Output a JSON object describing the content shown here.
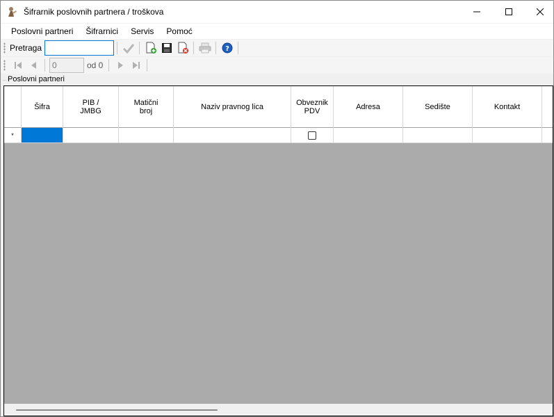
{
  "window": {
    "title": "Šifrarnik poslovnih partnera / troškova"
  },
  "menu": [
    "Poslovni partneri",
    "Šifrarnici",
    "Servis",
    "Pomoć"
  ],
  "search": {
    "label": "Pretraga",
    "value": "",
    "placeholder": ""
  },
  "toolbar": {
    "icons": [
      "check-icon",
      "add-document-icon",
      "save-icon",
      "delete-document-icon",
      "print-icon",
      "help-icon"
    ]
  },
  "navigator": {
    "position": "0",
    "of_label": "od 0"
  },
  "group": {
    "label": "Poslovni partneri"
  },
  "grid": {
    "columns": [
      "Šifra",
      "PIB /\nJMBG",
      "Matični\nbroj",
      "Naziv pravnog lica",
      "Obveznik\nPDV",
      "Adresa",
      "Sedište",
      "Kontakt"
    ],
    "new_row_marker": "*"
  },
  "colors": {
    "selection": "#0078d7",
    "grid_background": "#ababab"
  }
}
